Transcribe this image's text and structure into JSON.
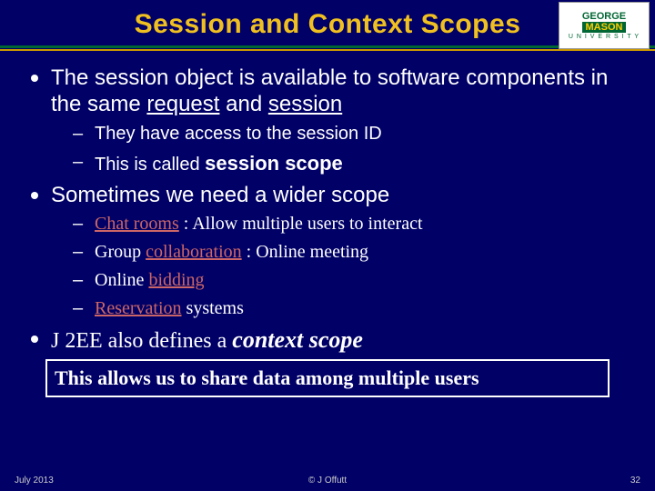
{
  "title": "Session and Context Scopes",
  "logo": {
    "line1": "GEORGE",
    "line2": "MASON",
    "line3": "U N I V E R S I T Y"
  },
  "b1_prefix": "The session object is available to software components in the same ",
  "b1_u1": "request",
  "b1_mid": " and ",
  "b1_u2": "session",
  "b1_s1": "They have access to the session ID",
  "b1_s2a": "This is called ",
  "b1_s2b": "session scope",
  "b2": "Sometimes we need a wider scope",
  "b2_s1a": "Chat rooms",
  "b2_s1b": " : Allow multiple users to interact",
  "b2_s2a": "Group ",
  "b2_s2b": "collaboration",
  "b2_s2c": " : Online meeting",
  "b2_s3a": "Online ",
  "b2_s3b": "bidding",
  "b2_s4a": "Reservation",
  "b2_s4b": " systems",
  "b3a": "J 2EE also defines a ",
  "b3b": "context scope",
  "callout": "This allows us to share data among multiple users",
  "footer": {
    "left": "July 2013",
    "center": "© J Offutt",
    "right": "32"
  }
}
